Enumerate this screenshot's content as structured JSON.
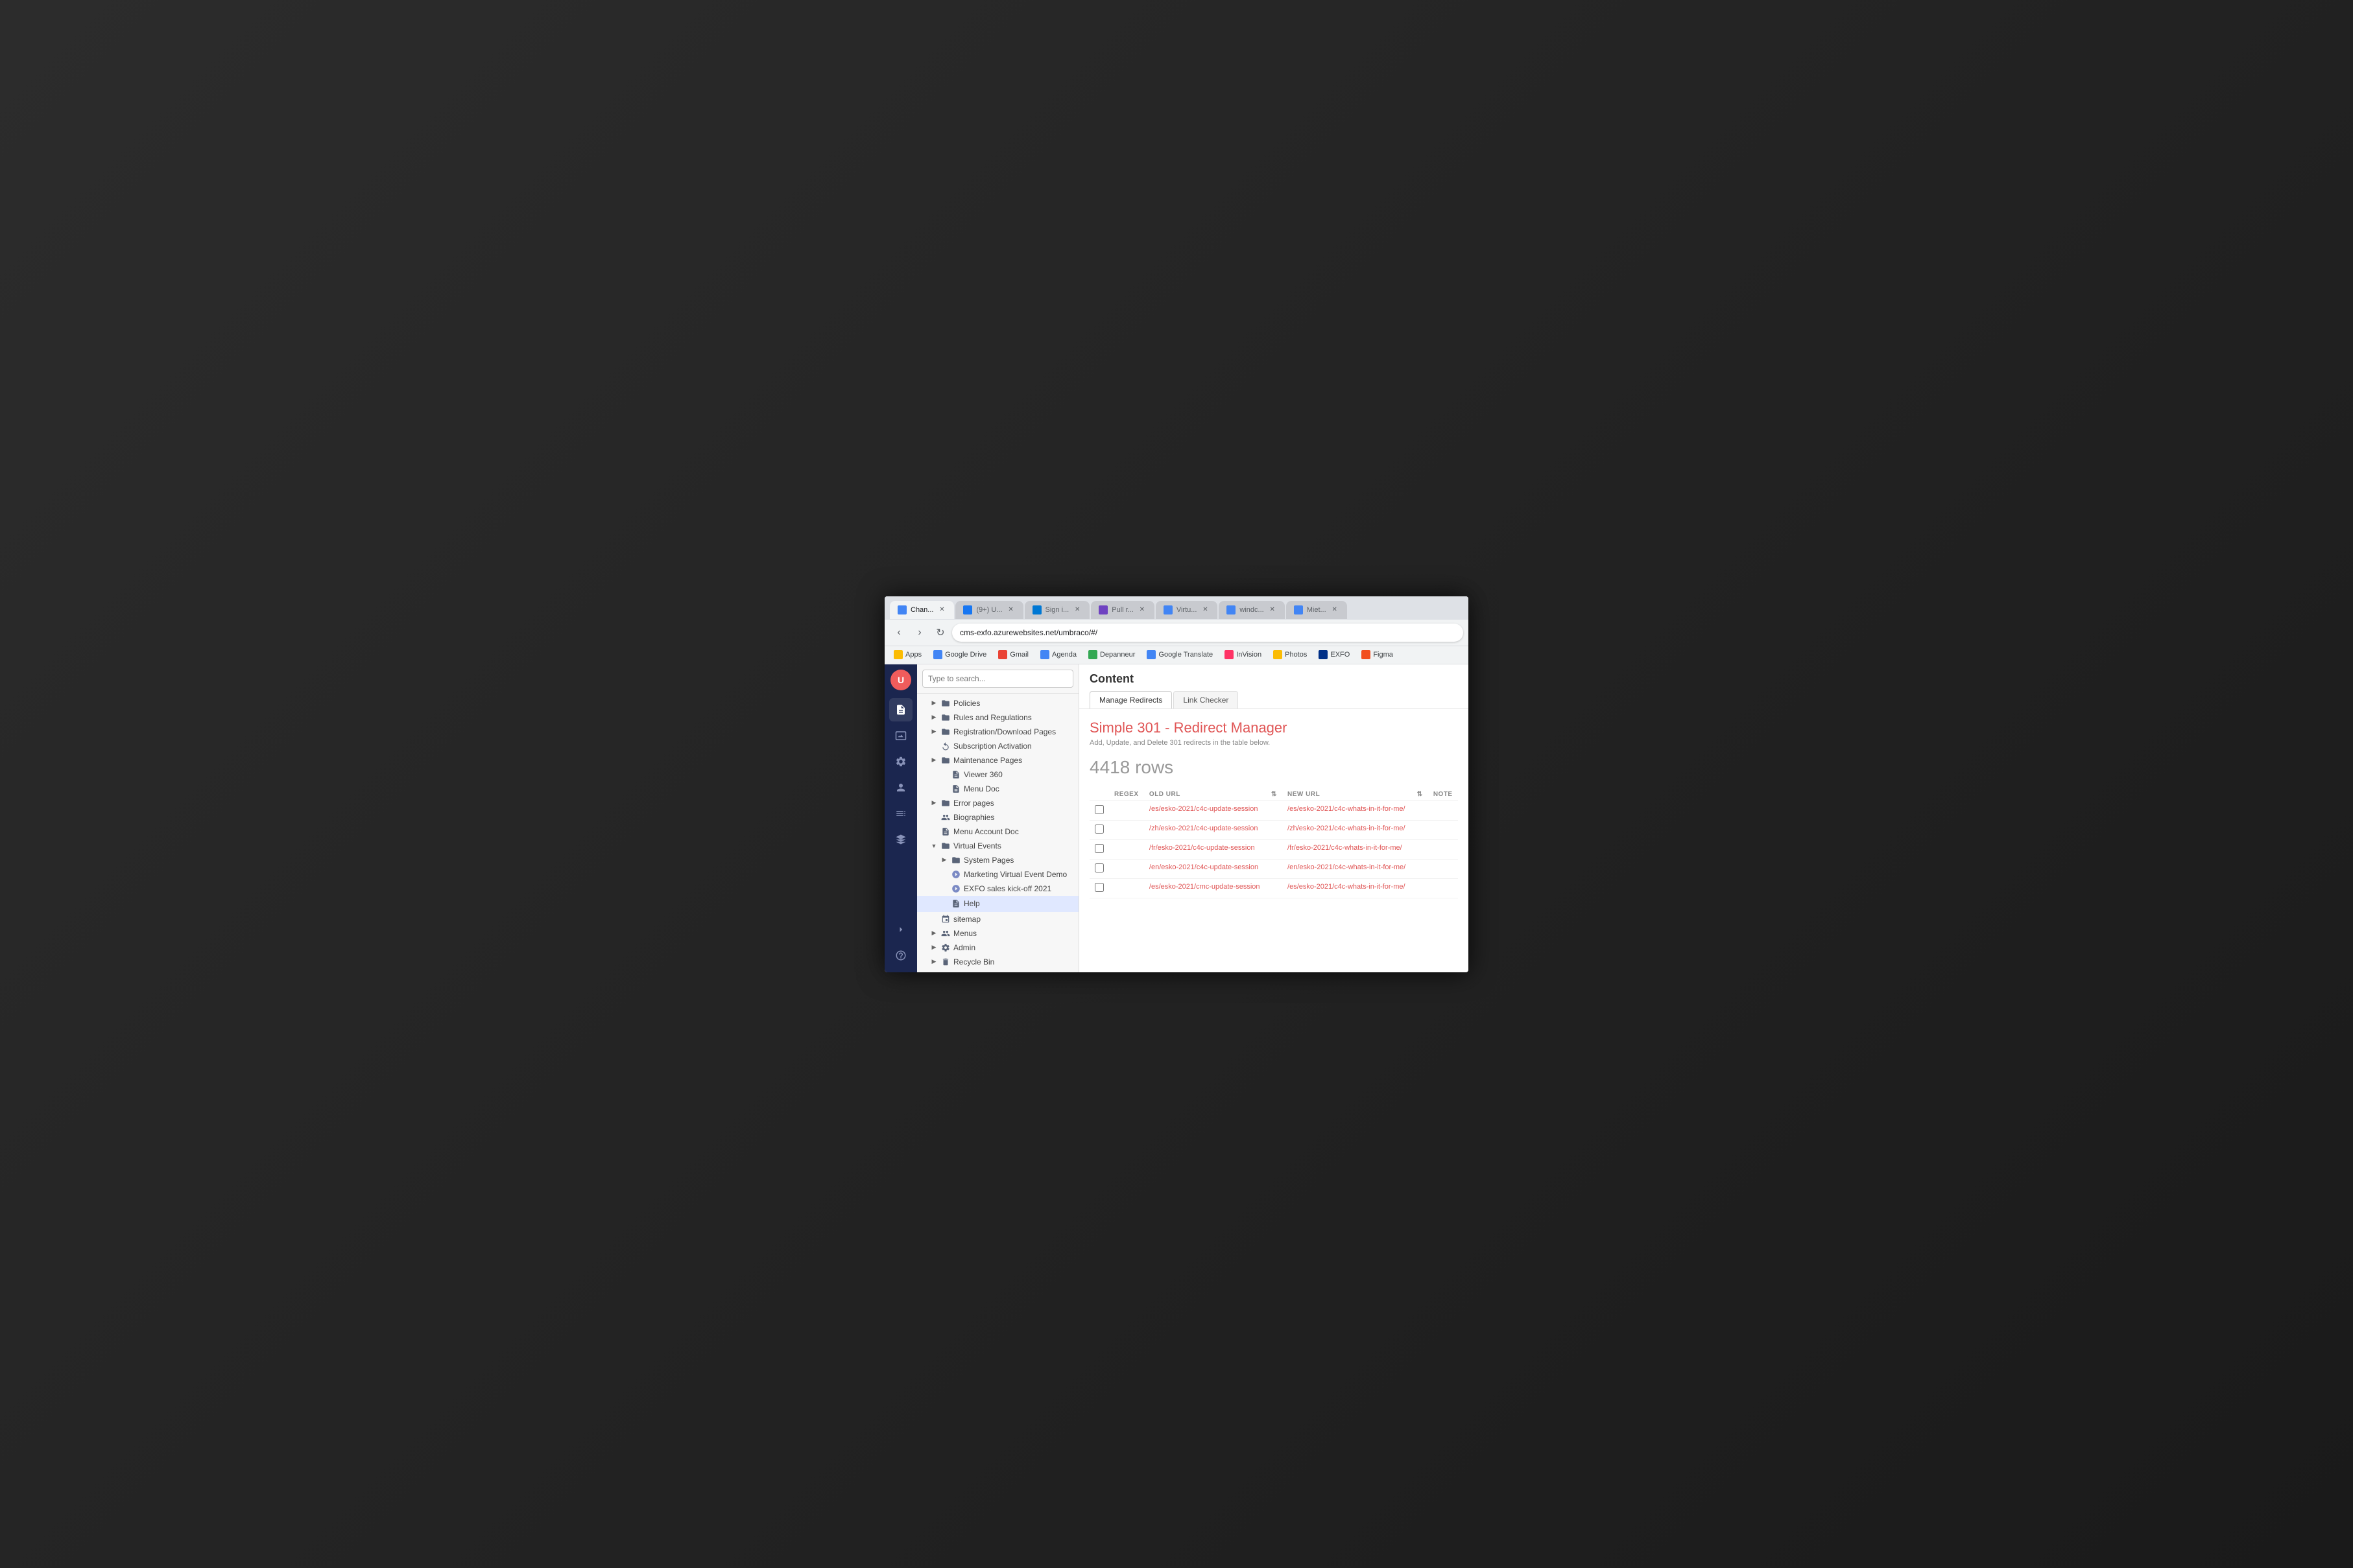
{
  "browser": {
    "tabs": [
      {
        "id": "t1",
        "label": "Chan...",
        "active": true,
        "icon_color": "#4285f4"
      },
      {
        "id": "t2",
        "label": "(9+) U...",
        "active": false,
        "icon_color": "#1877f2"
      },
      {
        "id": "t3",
        "label": "Sign i...",
        "active": false,
        "icon_color": "#0078d4"
      },
      {
        "id": "t4",
        "label": "Pull r...",
        "active": false,
        "icon_color": "#6f42c1"
      },
      {
        "id": "t5",
        "label": "Virtu...",
        "active": false,
        "icon_color": "#4285f4"
      },
      {
        "id": "t6",
        "label": "windc...",
        "active": false,
        "icon_color": "#4285f4"
      },
      {
        "id": "t7",
        "label": "Miet...",
        "active": false,
        "icon_color": "#4285f4"
      }
    ],
    "address": "cms-exfo.azurewebsites.net/umbraco/#/",
    "bookmarks": [
      {
        "label": "Apps",
        "icon_color": "#fbbc04"
      },
      {
        "label": "Google Drive",
        "icon_color": "#4285f4"
      },
      {
        "label": "Gmail",
        "icon_color": "#ea4335"
      },
      {
        "label": "Agenda",
        "icon_color": "#4285f4"
      },
      {
        "label": "Depanneur",
        "icon_color": "#34a853"
      },
      {
        "label": "Google Translate",
        "icon_color": "#4285f4"
      },
      {
        "label": "InVision",
        "icon_color": "#ff3366"
      },
      {
        "label": "Photos",
        "icon_color": "#fbbc04"
      },
      {
        "label": "EXFO",
        "icon_color": "#003087"
      },
      {
        "label": "Figma",
        "icon_color": "#f24e1e"
      }
    ]
  },
  "umbraco": {
    "sidebar": {
      "icons": [
        {
          "name": "content-icon",
          "symbol": "📄",
          "active": true
        },
        {
          "name": "media-icon",
          "symbol": "🖼"
        },
        {
          "name": "settings-icon",
          "symbol": "⚙"
        },
        {
          "name": "users-icon",
          "symbol": "👤"
        },
        {
          "name": "forms-icon",
          "symbol": "☰"
        },
        {
          "name": "deploy-icon",
          "symbol": "⬡"
        },
        {
          "name": "arrow-icon",
          "symbol": "➤"
        },
        {
          "name": "help-icon",
          "symbol": "?"
        }
      ]
    },
    "search": {
      "placeholder": "Type to search..."
    },
    "tree": {
      "items": [
        {
          "id": "policies",
          "label": "Policies",
          "indent": 1,
          "type": "folder",
          "expanded": false
        },
        {
          "id": "rules",
          "label": "Rules and Regulations",
          "indent": 1,
          "type": "folder",
          "expanded": false
        },
        {
          "id": "registration",
          "label": "Registration/Download Pages",
          "indent": 1,
          "type": "folder",
          "expanded": false
        },
        {
          "id": "subscription",
          "label": "Subscription Activation",
          "indent": 1,
          "type": "page",
          "expanded": false
        },
        {
          "id": "maintenance",
          "label": "Maintenance Pages",
          "indent": 1,
          "type": "folder",
          "expanded": false
        },
        {
          "id": "viewer360",
          "label": "Viewer 360",
          "indent": 2,
          "type": "page",
          "expanded": false
        },
        {
          "id": "menudoc",
          "label": "Menu Doc",
          "indent": 2,
          "type": "page",
          "expanded": false
        },
        {
          "id": "errorpages",
          "label": "Error pages",
          "indent": 1,
          "type": "folder",
          "expanded": false
        },
        {
          "id": "biographies",
          "label": "Biographies",
          "indent": 1,
          "type": "users",
          "expanded": false
        },
        {
          "id": "menuaccountdoc",
          "label": "Menu Account Doc",
          "indent": 1,
          "type": "page",
          "expanded": false
        },
        {
          "id": "virtualevents",
          "label": "Virtual Events",
          "indent": 1,
          "type": "folder",
          "expanded": true
        },
        {
          "id": "systempages",
          "label": "System Pages",
          "indent": 2,
          "type": "folder",
          "expanded": false
        },
        {
          "id": "marketingvirtual",
          "label": "Marketing Virtual Event Demo",
          "indent": 2,
          "type": "virtual",
          "expanded": false
        },
        {
          "id": "exfosales",
          "label": "EXFO sales kick-off 2021",
          "indent": 2,
          "type": "virtual",
          "expanded": false
        },
        {
          "id": "help",
          "label": "Help",
          "indent": 2,
          "type": "page",
          "expanded": false,
          "selected": true
        },
        {
          "id": "sitemap",
          "label": "sitemap",
          "indent": 1,
          "type": "sitemap",
          "expanded": false
        },
        {
          "id": "menus",
          "label": "Menus",
          "indent": 0,
          "type": "folder",
          "expanded": false
        },
        {
          "id": "admin",
          "label": "Admin",
          "indent": 0,
          "type": "folder",
          "expanded": false
        },
        {
          "id": "recyclebin",
          "label": "Recycle Bin",
          "indent": 0,
          "type": "folder",
          "expanded": false
        }
      ]
    },
    "content_panel": {
      "title": "Content",
      "tabs": [
        {
          "label": "Manage Redirects",
          "active": true
        },
        {
          "label": "Link Checker",
          "active": false
        }
      ],
      "redirect_manager": {
        "title": "Simple 301 - Redirect Manager",
        "subtitle": "Add, Update, and Delete 301 redirects in the table below.",
        "row_count": "4418 rows",
        "table": {
          "columns": [
            {
              "label": "REGEX",
              "sortable": false
            },
            {
              "label": "OLD URL",
              "sortable": true
            },
            {
              "label": "",
              "sortable": false
            },
            {
              "label": "NEW URL",
              "sortable": true
            },
            {
              "label": "",
              "sortable": false
            },
            {
              "label": "NOTE",
              "sortable": false
            }
          ],
          "rows": [
            {
              "checked": false,
              "old_url": "/es/esko-2021/c4c-update-session",
              "new_url": "/es/esko-2021/c4c-whats-in-it-for-me/",
              "note": ""
            },
            {
              "checked": false,
              "old_url": "/zh/esko-2021/c4c-update-session",
              "new_url": "/zh/esko-2021/c4c-whats-in-it-for-me/",
              "note": ""
            },
            {
              "checked": false,
              "old_url": "/fr/esko-2021/c4c-update-session",
              "new_url": "/fr/esko-2021/c4c-whats-in-it-for-me/",
              "note": ""
            },
            {
              "checked": false,
              "old_url": "/en/esko-2021/c4c-update-session",
              "new_url": "/en/esko-2021/c4c-whats-in-it-for-me/",
              "note": ""
            },
            {
              "checked": false,
              "old_url": "/es/esko-2021/cmc-update-session",
              "new_url": "/es/esko-2021/c4c-whats-in-it-for-me/",
              "note": ""
            }
          ]
        }
      }
    }
  }
}
